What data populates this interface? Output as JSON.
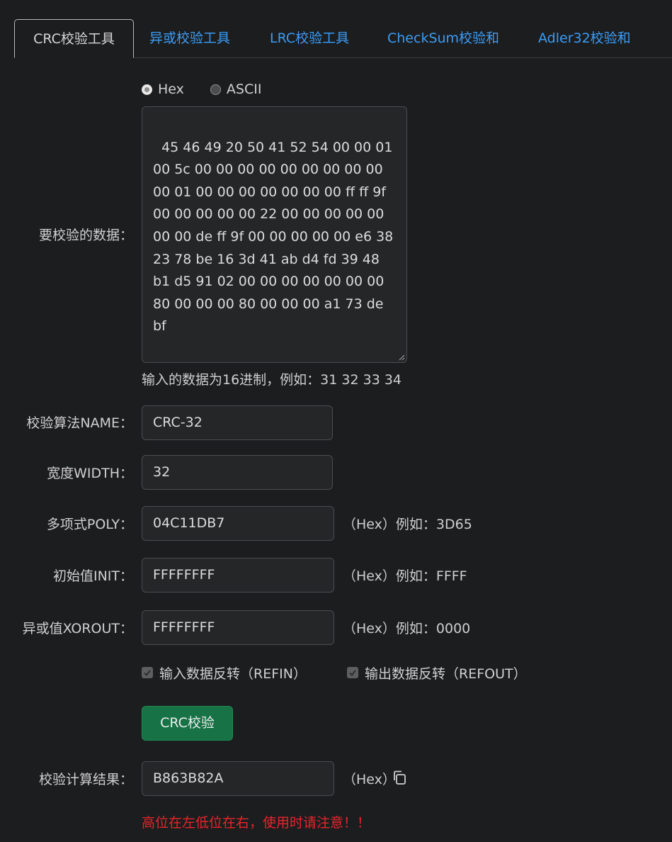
{
  "tabs": [
    {
      "label": "CRC校验工具",
      "active": true
    },
    {
      "label": "异或校验工具",
      "active": false
    },
    {
      "label": "LRC校验工具",
      "active": false
    },
    {
      "label": "CheckSum校验和",
      "active": false
    },
    {
      "label": "Adler32校验和",
      "active": false
    }
  ],
  "format": {
    "hex_label": "Hex",
    "ascii_label": "ASCII",
    "selected": "Hex"
  },
  "data_input": {
    "label": "要校验的数据：",
    "value": "45 46 49 20 50 41 52 54 00 00 01 00 5c 00 00 00 00 00 00 00 00 00 00 01 00 00 00 00 00 00 00 ff ff 9f 00 00 00 00 00 22 00 00 00 00 00 00 00 de ff 9f 00 00 00 00 00 e6 38 23 78 be 16 3d 41 ab d4 fd 39 48 b1 d5 91 02 00 00 00 00 00 00 00 80 00 00 00 80 00 00 00 a1 73 de bf",
    "hint": "输入的数据为16进制，例如：31 32 33 34"
  },
  "algorithm": {
    "name_label": "校验算法NAME：",
    "name_value": "CRC-32",
    "width_label": "宽度WIDTH：",
    "width_value": "32",
    "poly_label": "多项式POLY：",
    "poly_value": "04C11DB7",
    "poly_hint": "（Hex）例如：3D65",
    "init_label": "初始值INIT：",
    "init_value": "FFFFFFFF",
    "init_hint": "（Hex）例如：FFFF",
    "xorout_label": "异或值XOROUT：",
    "xorout_value": "FFFFFFFF",
    "xorout_hint": "（Hex）例如：0000"
  },
  "options": {
    "refin_label": "输入数据反转（REFIN）",
    "refin_checked": true,
    "refout_label": "输出数据反转（REFOUT）",
    "refout_checked": true
  },
  "actions": {
    "calc_button": "CRC校验"
  },
  "result": {
    "label": "校验计算结果：",
    "value": "B863B82A",
    "hint": "（Hex）",
    "copy_icon": "copy-icon"
  },
  "warning": "高位在左低位在右，使用时请注意！！",
  "colors": {
    "background": "#1c1d1f",
    "link": "#3b9cf5",
    "button": "#177245",
    "warning": "#e8252a"
  }
}
